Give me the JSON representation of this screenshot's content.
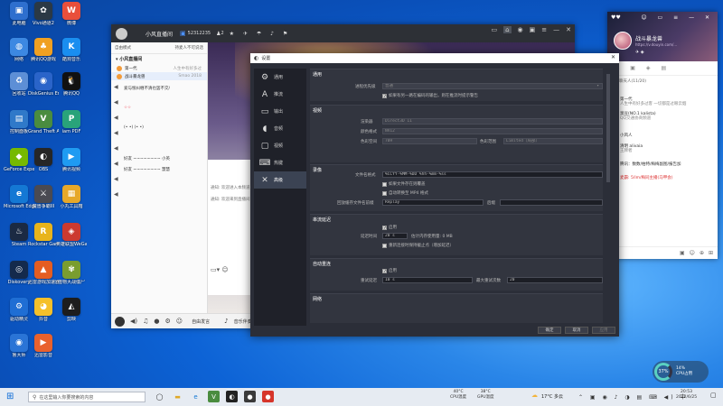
{
  "desktop_icons": [
    {
      "label": "此电脑",
      "color": "#2e6fce",
      "glyph": "▣"
    },
    {
      "label": "Vivo通道2",
      "color": "#2b3945",
      "glyph": "✿"
    },
    {
      "label": "微博",
      "color": "#e94f3b",
      "glyph": "W"
    },
    {
      "label": "网络",
      "color": "#3c88e2",
      "glyph": "◍"
    },
    {
      "label": "腾讯QQ游戏",
      "color": "#f0a021",
      "glyph": "♣"
    },
    {
      "label": "酷狗音乐",
      "color": "#1a8ef0",
      "glyph": "K"
    },
    {
      "label": "回收站",
      "color": "#5d8fd6",
      "glyph": "♻"
    },
    {
      "label": "DiskGenius Engineer",
      "color": "#2a64c9",
      "glyph": "◉"
    },
    {
      "label": "腾讯QQ",
      "color": "#111",
      "glyph": "🐧"
    },
    {
      "label": "控制面板",
      "color": "#2f79c9",
      "glyph": "▤"
    },
    {
      "label": "Grand Theft Auto V",
      "color": "#4a8c3f",
      "glyph": "V"
    },
    {
      "label": "iam PDF",
      "color": "#29a37a",
      "glyph": "P"
    },
    {
      "label": "GeForce Experience",
      "color": "#76b900",
      "glyph": "◆"
    },
    {
      "label": "OBS",
      "color": "#262626",
      "glyph": "◐"
    },
    {
      "label": "腾讯视频",
      "color": "#1f9bf2",
      "glyph": "▶"
    },
    {
      "label": "Microsoft Edge",
      "color": "#1478d4",
      "glyph": "e"
    },
    {
      "label": "魔兽争霸III",
      "color": "#4a4a52",
      "glyph": "⚔"
    },
    {
      "label": "小丸工具箱",
      "color": "#e6a82a",
      "glyph": "▦"
    },
    {
      "label": "Steam",
      "color": "#1b2a43",
      "glyph": "♨"
    },
    {
      "label": "Rockstar Games",
      "color": "#e8b41c",
      "glyph": "R"
    },
    {
      "label": "英雄联盟WeGame",
      "color": "#cc3a30",
      "glyph": "◈"
    },
    {
      "label": "Diskovery",
      "color": "#142a4c",
      "glyph": "◎"
    },
    {
      "label": "迅雷游戏加速器",
      "color": "#e45d22",
      "glyph": "▲"
    },
    {
      "label": "植物大战僵尸",
      "color": "#7a9d2f",
      "glyph": "✾"
    },
    {
      "label": "驱动精灵",
      "color": "#1f6ed4",
      "glyph": "⚙"
    },
    {
      "label": "抖音",
      "color": "#f5c02a",
      "glyph": "◕"
    },
    {
      "label": "剪映",
      "color": "#1d1d1d",
      "glyph": "◭"
    },
    {
      "label": "鲁大师",
      "color": "#2a74d6",
      "glyph": "◉"
    },
    {
      "label": "迅雷影音",
      "color": "#e9612d",
      "glyph": "▶"
    }
  ],
  "qq_window": {
    "title": "小风直播间",
    "room_id": "52312235",
    "online_count": "2",
    "mode_label": "自由模式",
    "mode_right": "持麦人不可说话",
    "channel_name": "小风直播间",
    "members": [
      {
        "name": "第一代",
        "note": "人生中有好多过"
      },
      {
        "name": "战斗暴龙兽",
        "note": "Smao 2018"
      }
    ],
    "chat_lines": [
      "爱与恨纠缠不清也罢不交/",
      "☆☆",
      "(• •)     (• •)",
      "好友 ~~~~~~~~ 小英",
      "好友 ~~~~~~~~ 慧慧"
    ],
    "notices": [
      "通知: 欢迎进入本频道",
      "通知: 欢迎来到直播间"
    ],
    "bottom_labels": [
      "自由发言",
      "音乐伴奏"
    ]
  },
  "settings": {
    "title": "设置",
    "nav": [
      {
        "label": "通用",
        "icon": "gear-icon",
        "glyph": "⚙"
      },
      {
        "label": "推流",
        "icon": "broadcast-icon",
        "glyph": "A"
      },
      {
        "label": "输出",
        "icon": "output-icon",
        "glyph": "▭"
      },
      {
        "label": "音频",
        "icon": "audio-icon",
        "glyph": "◖"
      },
      {
        "label": "视频",
        "icon": "monitor-icon",
        "glyph": "▢"
      },
      {
        "label": "热键",
        "icon": "keyboard-icon",
        "glyph": "⌨"
      },
      {
        "label": "高级",
        "icon": "wrench-icon",
        "glyph": "✕"
      }
    ],
    "active_nav": "高级",
    "general": {
      "header": "通用",
      "process_priority_label": "进程优先级",
      "process_priority_value": "普通",
      "checkbox_label": "如果有另一路在编码的输出，则在推流时提示警告"
    },
    "video": {
      "header": "视频",
      "renderer_label": "渲染器",
      "renderer_value": "Direct3D 11",
      "color_format_label": "颜色格式",
      "color_format_value": "NV12",
      "color_space_label": "色彩空间",
      "color_space_value": "709",
      "color_range_label": "色彩范围",
      "color_range_value": "Limited（局部）"
    },
    "recording": {
      "header": "录像",
      "filename_label": "文件名格式",
      "filename_value": "%CCYY-%MM-%DD %hh-%mm-%ss",
      "overwrite_label": "如果文件存在则覆盖",
      "remux_label": "自动转换至 MP4 格式",
      "replay_label": "回放缓存文件名前缀",
      "replay_value": "Replay",
      "suffix_label": "后缀"
    },
    "stream_delay": {
      "header": "串流延迟",
      "enable_label": "启用",
      "duration_label": "延迟时间",
      "duration_value": "20 s",
      "memory_note": "估计内存使用量: 0 MB",
      "preserve_label": "重新连接时保持截止点（增加延迟）"
    },
    "auto_reconnect": {
      "header": "自动重连",
      "enable_label": "启用",
      "retry_delay_label": "重试延迟",
      "retry_delay_value": "10 s",
      "max_retries_label": "最大重试次数",
      "max_retries_value": "20"
    },
    "network": {
      "header": "网络"
    },
    "buttons": {
      "ok": "确定",
      "cancel": "取消",
      "apply": "应用"
    }
  },
  "chat_window": {
    "username": "战斗暴龙兽",
    "link": "https://v.douyin.com/...",
    "room_tab": "频道聊天人(11/20)",
    "messages": [
      {
        "name": "第一代",
        "text": "人生中有好多过客 一切都是过眼云烟",
        "color": "#6b9bd8"
      },
      {
        "name": "臭豆(NO.1 kalista)",
        "text": "QQ交通协商频道",
        "color": "#d89b6b"
      },
      {
        "name": "小风人",
        "text": "",
        "color": "#b0b0b0"
      },
      {
        "name": "清明 alivaia",
        "text": "王牌者",
        "color": "#9b6bd8"
      },
      {
        "name": "腾讯：数数/柏特/梅梅副图/报告加",
        "text": "",
        "color": "#d86b8f"
      },
      {
        "name": "麦霸: 5/lm/梅同主播(马甲会)",
        "text": "",
        "color": "#d84b4b"
      }
    ]
  },
  "taskbar": {
    "search_placeholder": "在这里输入你要搜索的内容",
    "cpu_temp": "40°C",
    "cpu_temp_label": "CPU温度",
    "gpu_temp": "38°C",
    "gpu_temp_label": "GPU温度",
    "weather": "17°C 多云",
    "time": "20:53",
    "date": "2022/6/25"
  },
  "cpu_widget": {
    "percent": "37%",
    "usage": "14%",
    "label": "CPU占用"
  }
}
